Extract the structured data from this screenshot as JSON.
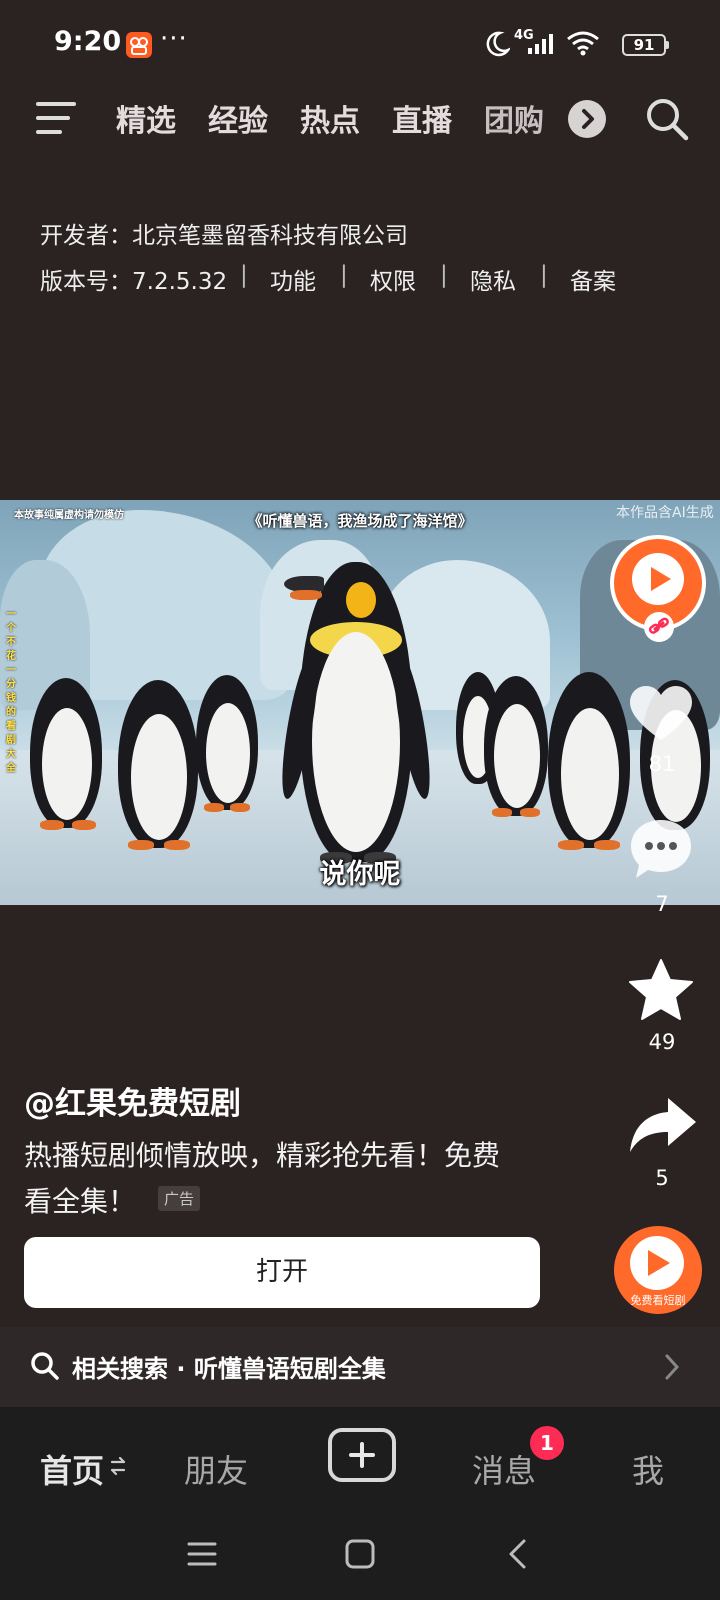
{
  "status_bar": {
    "time": "9:20",
    "more": "···",
    "network": "4G",
    "battery": "91"
  },
  "top_nav": {
    "tabs": [
      "精选",
      "经验",
      "热点",
      "直播",
      "团购"
    ]
  },
  "app_info": {
    "developer_label": "开发者：北京笔墨留香科技有限公司",
    "version_label": "版本号：7.2.5.32",
    "links": [
      "功能",
      "权限",
      "隐私",
      "备案"
    ],
    "separator": "|"
  },
  "video": {
    "disclaimer_left": "本故事纯属虚构请勿模仿",
    "title_overlay": "《听懂兽语，我渔场成了海洋馆》",
    "ai_notice": "本作品含AI生成",
    "vertical_text": "一个不花一分钱的看剧大全",
    "subtitle": "说你呢"
  },
  "side_actions": {
    "like_count": "81",
    "comment_count": "7",
    "favorite_count": "49",
    "share_count": "5",
    "music_label": "免费看短剧"
  },
  "caption": {
    "author": "@红果免费短剧",
    "description_line1": "热播短剧倾情放映，精彩抢先看！免费",
    "description_line2": "看全集！",
    "ad_badge": "广告",
    "open_button": "打开"
  },
  "related_search": {
    "label": "相关搜索 · 听懂兽语短剧全集"
  },
  "bottom_tabs": {
    "home": "首页",
    "friends": "朋友",
    "messages": "消息",
    "messages_badge": "1",
    "me": "我"
  },
  "colors": {
    "background": "#2b2222",
    "tab_bar": "#1d1d1d",
    "badge": "#fe2c55",
    "app_accent": "#ff5a1f"
  }
}
